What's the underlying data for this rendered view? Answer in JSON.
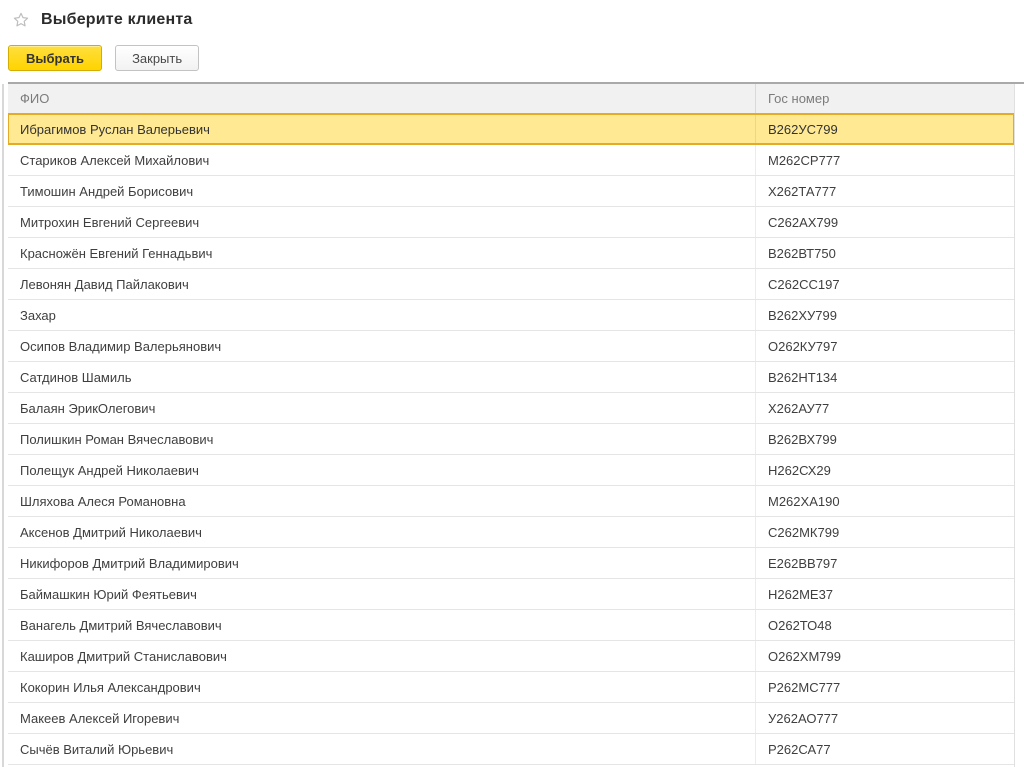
{
  "window": {
    "title": "Выберите клиента"
  },
  "toolbar": {
    "select_label": "Выбрать",
    "close_label": "Закрыть"
  },
  "table": {
    "columns": [
      "ФИО",
      "Гос номер"
    ],
    "selected_index": 0,
    "rows": [
      {
        "fio": "Ибрагимов Руслан Валерьевич",
        "gos": "В262УС799"
      },
      {
        "fio": "Стариков Алексей Михайлович",
        "gos": "М262СР777"
      },
      {
        "fio": "Тимошин Андрей Борисович",
        "gos": "Х262ТА777"
      },
      {
        "fio": "Митрохин Евгений Сергеевич",
        "gos": "С262АХ799"
      },
      {
        "fio": "Красножён Евгений Геннадьвич",
        "gos": "В262ВТ750"
      },
      {
        "fio": "Левонян Давид Пайлакович",
        "gos": "С262СС197"
      },
      {
        "fio": "Захар",
        "gos": "В262ХУ799"
      },
      {
        "fio": "Осипов Владимир Валерьянович",
        "gos": "О262КУ797"
      },
      {
        "fio": "Сатдинов Шамиль",
        "gos": "В262НТ134"
      },
      {
        "fio": "Балаян ЭрикОлегович",
        "gos": "Х262АУ77"
      },
      {
        "fio": "Полишкин Роман Вячеславович",
        "gos": "В262ВХ799"
      },
      {
        "fio": "Полещук Андрей Николаевич",
        "gos": "Н262СХ29"
      },
      {
        "fio": "Шляхова Алеся Романовна",
        "gos": "М262ХА190"
      },
      {
        "fio": "Аксенов Дмитрий Николаевич",
        "gos": "С262МК799"
      },
      {
        "fio": "Никифоров Дмитрий Владимирович",
        "gos": "Е262ВВ797"
      },
      {
        "fio": "Баймашкин Юрий Феятьевич",
        "gos": "Н262МЕ37"
      },
      {
        "fio": "Ванагель Дмитрий Вячеславович",
        "gos": "О262ТО48"
      },
      {
        "fio": "Каширов Дмитрий Станиславович",
        "gos": "О262ХМ799"
      },
      {
        "fio": "Кокорин Илья Александрович",
        "gos": "Р262МС777"
      },
      {
        "fio": "Макеев Алексей Игоревич",
        "gos": "У262АО777"
      },
      {
        "fio": "Сычёв Виталий Юрьевич",
        "gos": "Р262СА77"
      }
    ]
  },
  "colors": {
    "accent_yellow": "#ffd400",
    "selection_fill": "#ffe993",
    "selection_border": "#e4ac26",
    "header_bg": "#f1f1f1",
    "header_text": "#7b7b7b",
    "row_separator": "#e5e5e5",
    "table_top_border": "#a9a9a9"
  }
}
